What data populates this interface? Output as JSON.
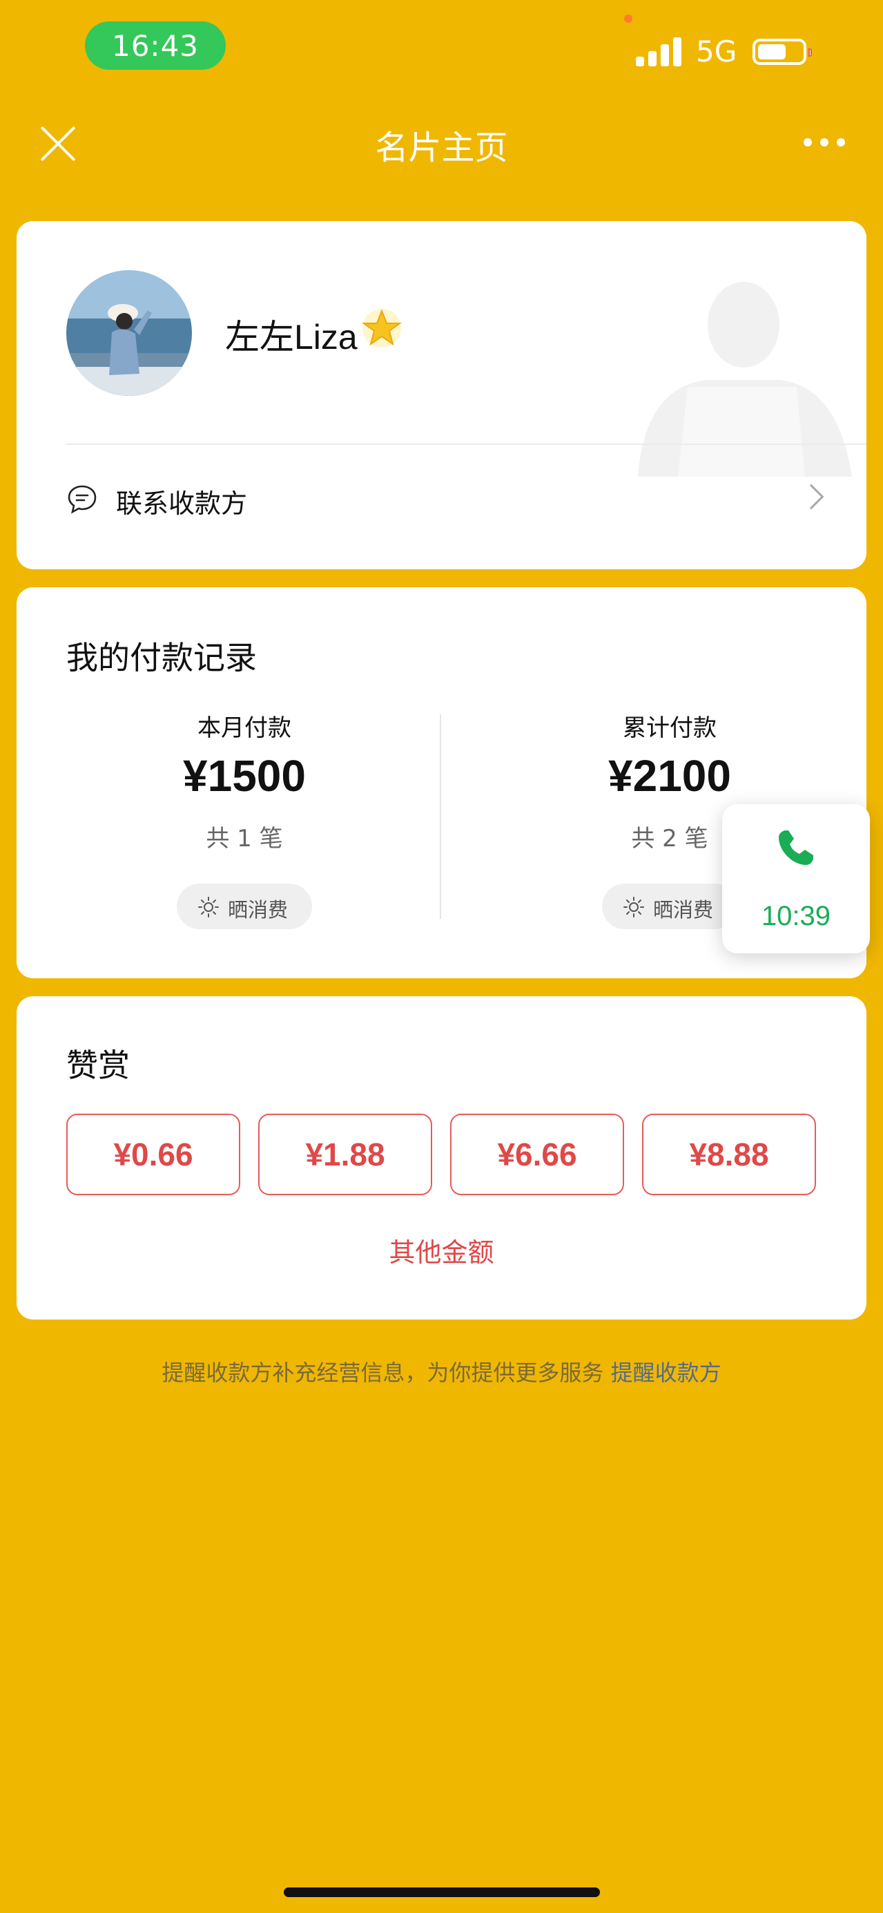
{
  "status_bar": {
    "time": "16:43",
    "network": "5G",
    "battery_percent": 55
  },
  "nav": {
    "title": "名片主页",
    "close_icon": "close-icon",
    "more_icon": "more-icon"
  },
  "profile": {
    "name": "左左Liza",
    "badge_icon": "star-icon",
    "contact_label": "联系收款方"
  },
  "records": {
    "title": "我的付款记录",
    "monthly": {
      "label": "本月付款",
      "amount": "¥1500",
      "count": "共 1 笔",
      "share_label": "晒消费"
    },
    "total": {
      "label": "累计付款",
      "amount": "¥2100",
      "count": "共 2 笔",
      "share_label": "晒消费"
    }
  },
  "call": {
    "time": "10:39",
    "accent": "#1AAD55"
  },
  "reward": {
    "title": "赞赏",
    "options": [
      "¥0.66",
      "¥1.88",
      "¥6.66",
      "¥8.88"
    ],
    "other_label": "其他金额",
    "accent": "#E04848"
  },
  "footer": {
    "text": "提醒收款方补充经营信息，为你提供更多服务 ",
    "link": "提醒收款方"
  },
  "colors": {
    "background": "#F0B700",
    "card": "#FFFFFF"
  }
}
